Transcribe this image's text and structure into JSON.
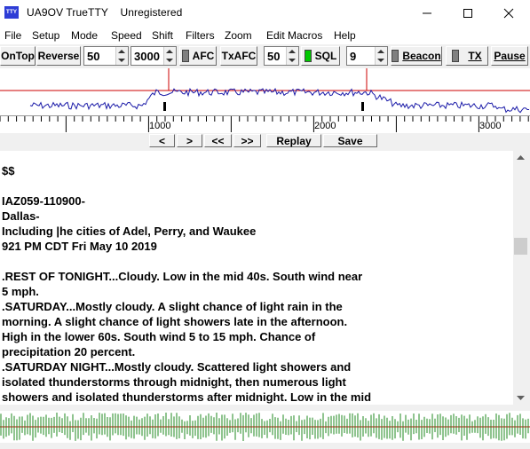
{
  "title_bar": {
    "app_icon_text": "TTY",
    "title": "UA9OV TrueTTY    Unregistered"
  },
  "menu": [
    "File",
    "Setup",
    "Mode",
    "Speed",
    "Shift",
    "Filters",
    "Zoom",
    "Edit Macros",
    "Help"
  ],
  "toolbar": {
    "ontop": "OnTop",
    "reverse": "Reverse",
    "speed_value": "50",
    "shift_value": "3000",
    "afc": "AFC",
    "txafc": "TxAFC",
    "filter_value": "50",
    "sql": "SQL",
    "sql_value": "9",
    "beacon": "Beacon",
    "tx": "TX",
    "pause": "Pause",
    "sql_led_color": "#00c800",
    "off_led_color": "#808080"
  },
  "scale": {
    "ticks": [
      "1000",
      "2000",
      "3000"
    ]
  },
  "nav": {
    "prev": "<",
    "next": ">",
    "rewind": "<<",
    "forward": ">>",
    "replay": "Replay",
    "save": "Save"
  },
  "received_text": [
    "$$",
    "",
    "IAZ059-110900-",
    "Dallas-",
    "Including |he cities of Adel, Perry, and Waukee",
    "921 PM CDT Fri May 10 2019",
    "",
    ".REST OF TONIGHT...Cloudy. Low in the mid 40s. South wind near",
    "5 mph.",
    ".SATURDAY...Mostly cloudy. A slight chance of light rain in the",
    "morning. A slight chance of light showers late in the afternoon.",
    "High in the lower 60s. South wind 5 to 15 mph. Chance of",
    "precipitation 20 percent.",
    ".SATURDAY NIGHT...Mostly cloudy. Scattered light showers and",
    "isolated thunderstorms through midnight, then numerous light",
    "showers and isolated thunderstorms after midnight. Low in the mid"
  ]
}
